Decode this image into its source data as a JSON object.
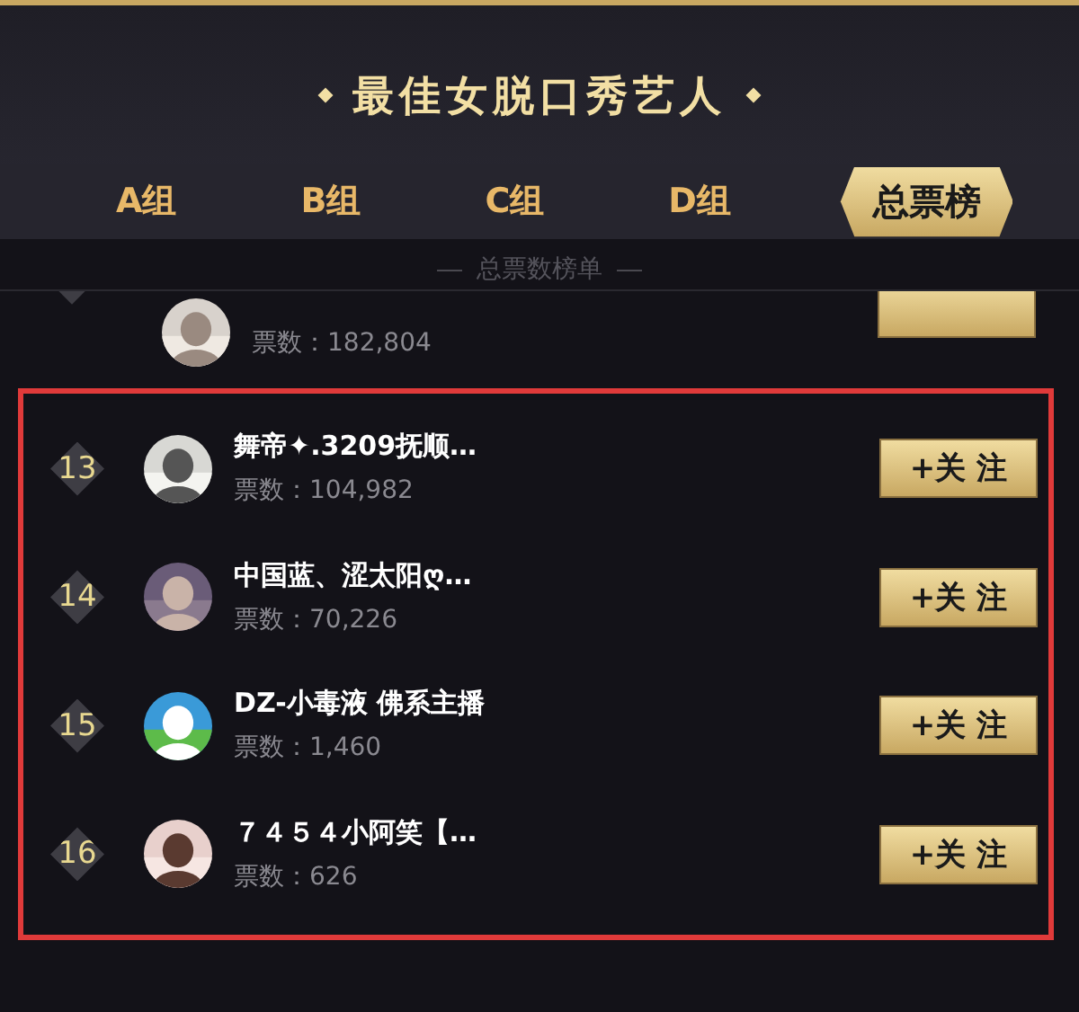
{
  "title": "最佳女脱口秀艺人",
  "tabs": [
    {
      "label": "A组",
      "selected": false
    },
    {
      "label": "B组",
      "selected": false
    },
    {
      "label": "C组",
      "selected": false
    },
    {
      "label": "D组",
      "selected": false
    },
    {
      "label": "总票榜",
      "selected": true
    }
  ],
  "list_title": "总票数榜单",
  "partial_row": {
    "votes": "票数：182,804"
  },
  "rows": [
    {
      "rank": "13",
      "name": "舞帝✦.3209抚顺…",
      "votes": "票数：104,982",
      "button": "+关 注"
    },
    {
      "rank": "14",
      "name": "中国蓝、涩太阳ღ…",
      "votes": "票数：70,226",
      "button": "+关 注"
    },
    {
      "rank": "15",
      "name": "DZ-小毒液 佛系主播",
      "votes": "票数：1,460",
      "button": "+关 注"
    },
    {
      "rank": "16",
      "name": "７４５４小阿笑【…",
      "votes": "票数：626",
      "button": "+关 注"
    }
  ]
}
